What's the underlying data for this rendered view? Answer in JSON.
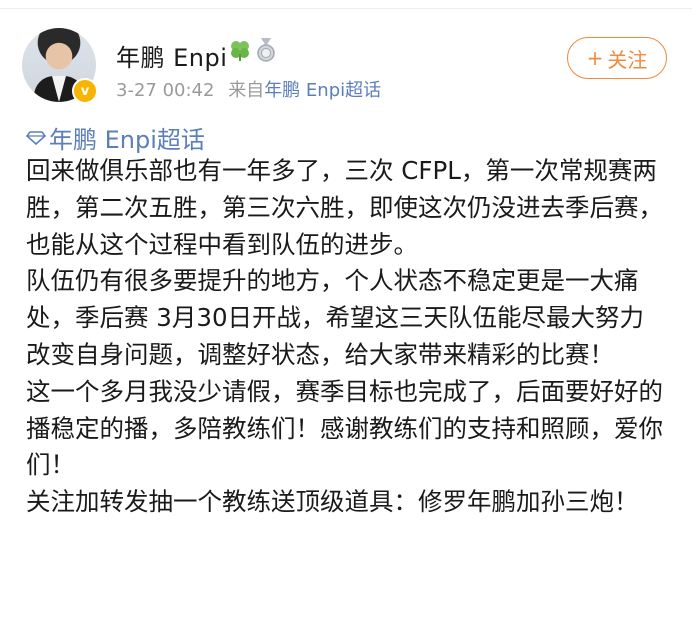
{
  "post": {
    "author": {
      "name": "年鹏 Enpi",
      "badges": [
        "clover-icon",
        "medal-icon"
      ],
      "verified": true
    },
    "meta": {
      "time": "3-27 00:42",
      "source_prefix": "来自",
      "source_name": "年鹏 Enpi超话"
    },
    "follow_label": "关注",
    "topic": "年鹏 Enpi超话",
    "paragraphs": [
      "回来做俱乐部也有一年多了，三次 CFPL，第一次常规赛两胜，第二次五胜，第三次六胜，即使这次仍没进去季后赛，也能从这个过程中看到队伍的进步。",
      "队伍仍有很多要提升的地方，个人状态不稳定更是一大痛处，季后赛 3月30日开战，希望这三天队伍能尽最大努力改变自身问题，调整好状态，给大家带来精彩的比赛！",
      "这一个多月我没少请假，赛季目标也完成了，后面要好好的播稳定的播，多陪教练们！感谢教练们的支持和照顾，爱你们！",
      "关注加转发抽一个教练送顶级道具：修罗年鹏加孙三炮！"
    ]
  },
  "colors": {
    "follow_orange": "#f08a3c",
    "link_blue": "#5b7fb8",
    "meta_gray": "#9a9a9a",
    "verified_gold": "#f7b500"
  }
}
